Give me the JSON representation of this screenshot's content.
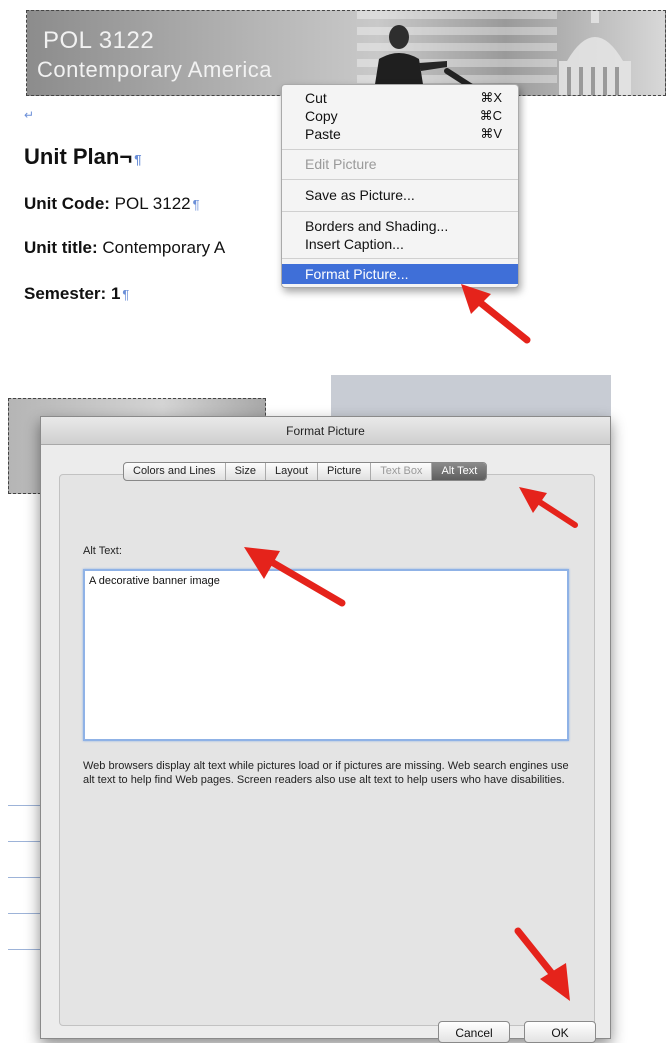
{
  "document": {
    "banner": {
      "title": "POL 3122",
      "subtitle": "Contemporary America"
    },
    "heading": "Unit Plan¬",
    "unit_code_label": "Unit Code:",
    "unit_code_value": "POL 3122",
    "unit_title_label": "Unit title:",
    "unit_title_value": "Contemporary A",
    "semester_label": "Semester:",
    "semester_value": "1",
    "pilcrow": "¶",
    "return_mark": "↵"
  },
  "context_menu": {
    "items": [
      {
        "label": "Cut",
        "shortcut": "⌘X"
      },
      {
        "label": "Copy",
        "shortcut": "⌘C"
      },
      {
        "label": "Paste",
        "shortcut": "⌘V"
      },
      {
        "label": "Edit Picture",
        "disabled": true
      },
      {
        "label": "Save as Picture..."
      },
      {
        "label": "Borders and Shading..."
      },
      {
        "label": "Insert Caption..."
      },
      {
        "label": "Format Picture...",
        "selected": true
      }
    ]
  },
  "dialog": {
    "title": "Format Picture",
    "tabs": [
      {
        "label": "Colors and Lines"
      },
      {
        "label": "Size"
      },
      {
        "label": "Layout"
      },
      {
        "label": "Picture"
      },
      {
        "label": "Text Box",
        "disabled": true
      },
      {
        "label": "Alt Text",
        "active": true
      }
    ],
    "alt_text_label": "Alt Text:",
    "alt_text_value": "A decorative banner image",
    "help_text": "Web browsers display alt text while pictures load or if pictures are missing. Web search engines use alt text to help find Web pages. Screen readers also use alt text to help users who have disabilities.",
    "cancel_label": "Cancel",
    "ok_label": "OK"
  },
  "colors": {
    "menu_highlight": "#3f6fd8",
    "arrow_red": "#e5231b",
    "textarea_focus": "#8fb2e6",
    "active_tab": "#5e5e5e"
  },
  "icons": [
    "red-pointer-arrow-icon",
    "pilcrow-icon",
    "return-arrow-icon"
  ]
}
